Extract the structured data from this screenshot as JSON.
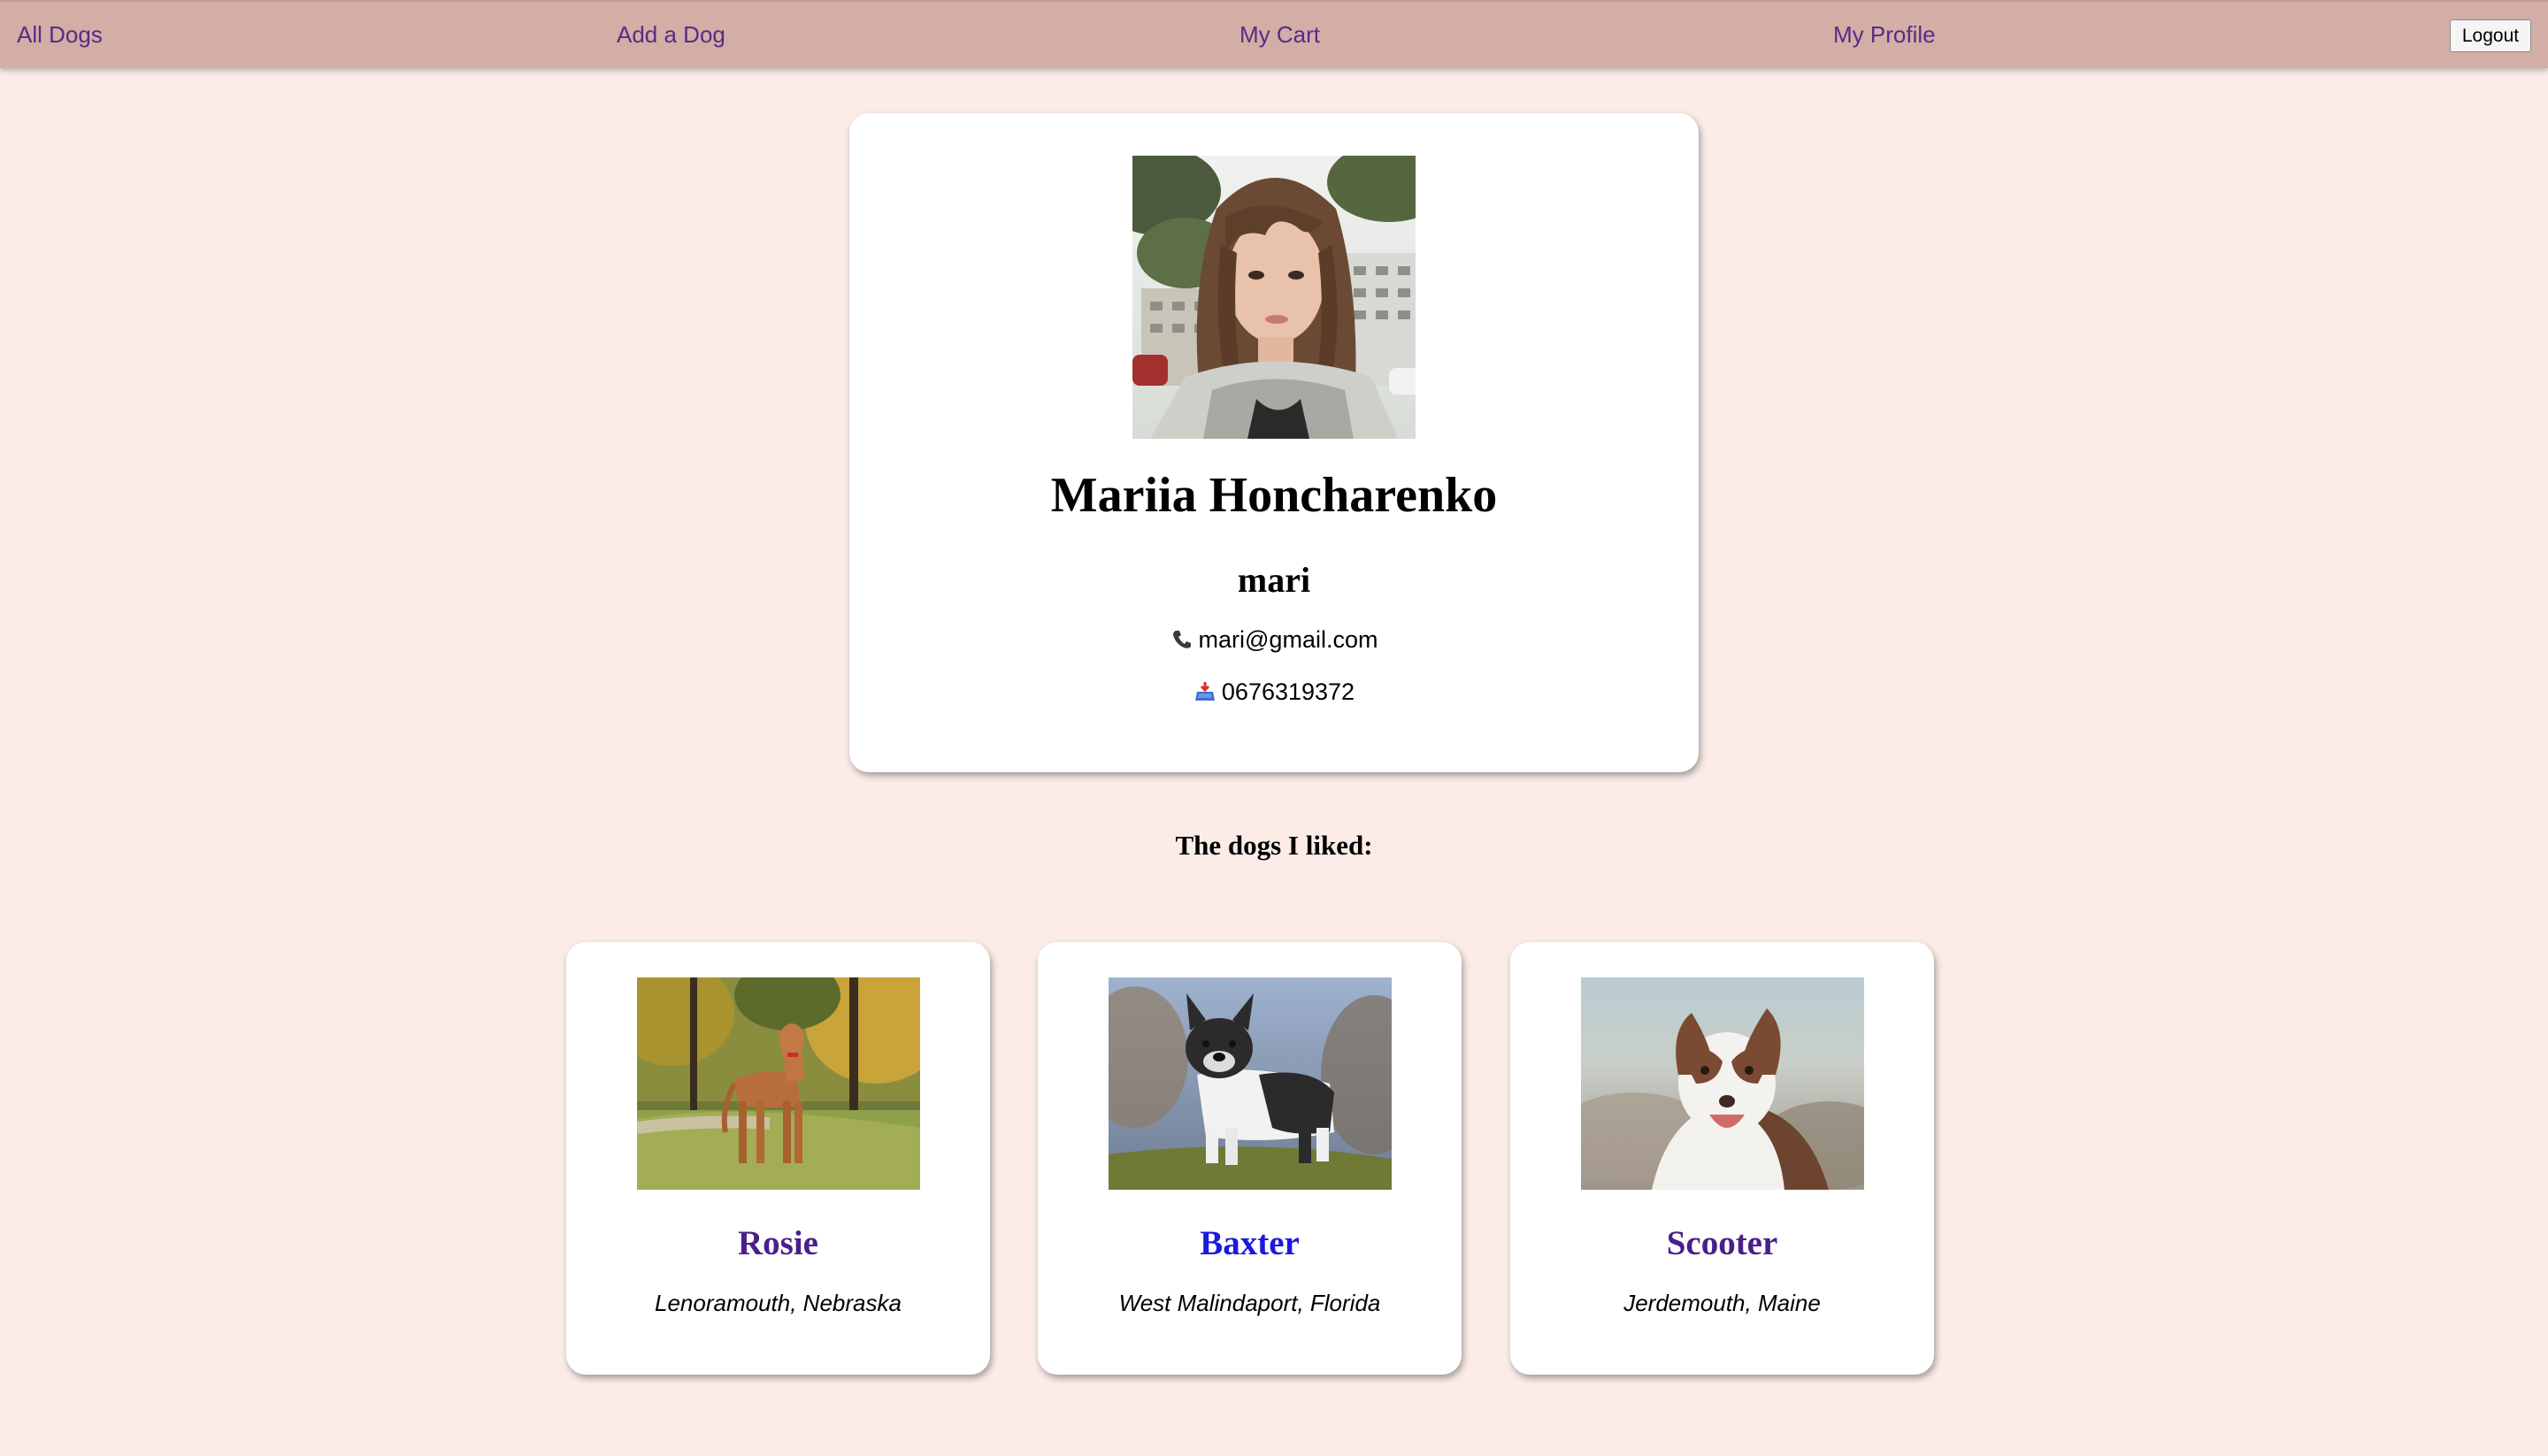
{
  "nav": {
    "all_dogs": "All Dogs",
    "add_dog": "Add a Dog",
    "my_cart": "My Cart",
    "my_profile": "My Profile",
    "logout": "Logout",
    "link_color": "#5b2a86",
    "bar_color": "#d2aea6"
  },
  "profile": {
    "full_name": "Mariia Honcharenko",
    "username": "mari",
    "email": "mari@gmail.com",
    "email_icon": "phone-icon",
    "phone": "0676319372",
    "phone_icon": "inbox-tray-icon"
  },
  "liked_section": {
    "title": "The dogs I liked:"
  },
  "dogs": [
    {
      "name": "Rosie",
      "location": "Lenoramouth, Nebraska",
      "name_color": "#4b1f8a"
    },
    {
      "name": "Baxter",
      "location": "West Malindaport, Florida",
      "name_color": "#1a1adf"
    },
    {
      "name": "Scooter",
      "location": "Jerdemouth, Maine",
      "name_color": "#4b1f8a"
    }
  ]
}
